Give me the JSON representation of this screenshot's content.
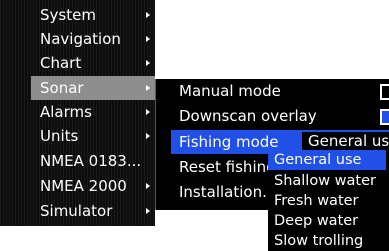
{
  "main_menu": {
    "items": [
      {
        "label": "System",
        "has_submenu": true
      },
      {
        "label": "Navigation",
        "has_submenu": true
      },
      {
        "label": "Chart",
        "has_submenu": true
      },
      {
        "label": "Sonar",
        "has_submenu": true,
        "selected": true
      },
      {
        "label": "Alarms",
        "has_submenu": true
      },
      {
        "label": "Units",
        "has_submenu": true
      },
      {
        "label": "NMEA 0183...",
        "has_submenu": false
      },
      {
        "label": "NMEA 2000",
        "has_submenu": true
      },
      {
        "label": "Simulator",
        "has_submenu": true
      }
    ]
  },
  "sonar_menu": {
    "items": [
      {
        "label": "Manual mode",
        "checked": false
      },
      {
        "label": "Downscan overlay",
        "checked": true
      },
      {
        "label": "Fishing mode",
        "value": "General use",
        "selected": true
      },
      {
        "label": "Reset fishing"
      },
      {
        "label": "Installation..."
      }
    ]
  },
  "fishing_mode_dropdown": {
    "options": [
      "General use",
      "Shallow water",
      "Fresh water",
      "Deep water",
      "Slow trolling"
    ],
    "selected": "General use"
  },
  "colors": {
    "selection_blue": "#2050e8",
    "main_selected_gray": "#8e8e8e",
    "menu_bg": "#000000"
  }
}
